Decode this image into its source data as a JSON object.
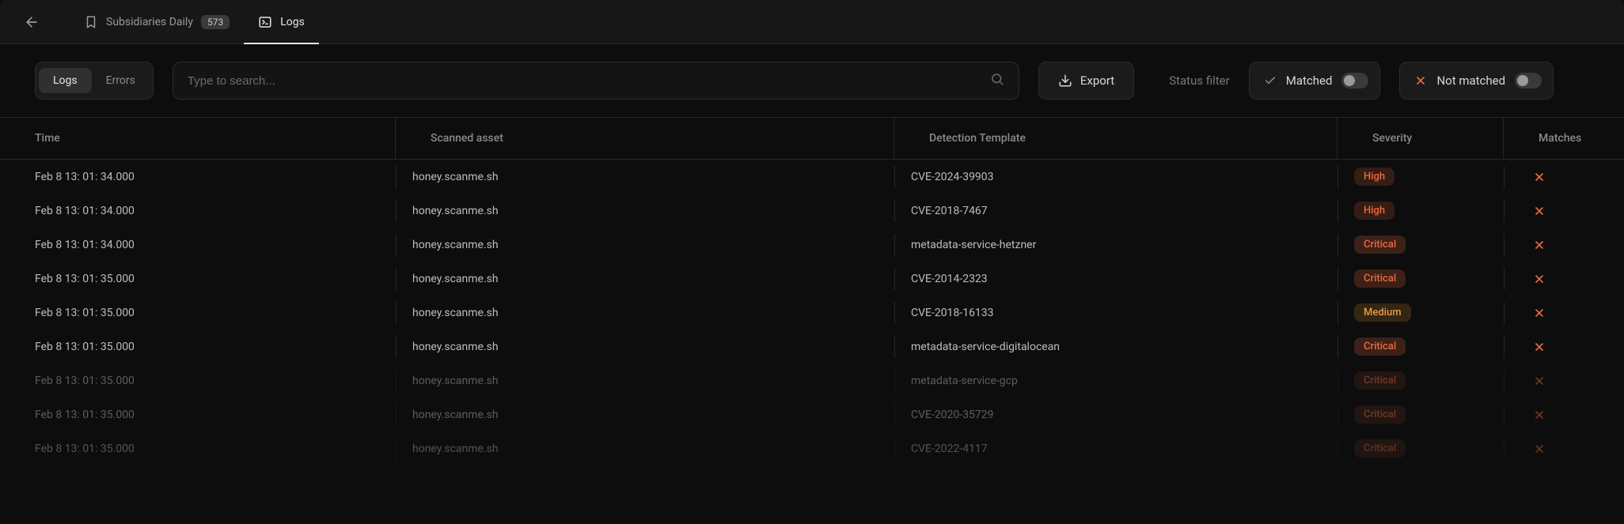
{
  "tabs": {
    "subsidiaries": {
      "label": "Subsidiaries Daily",
      "count": "573"
    },
    "logs": {
      "label": "Logs"
    }
  },
  "toolbar": {
    "segmented": {
      "logs": "Logs",
      "errors": "Errors"
    },
    "search_placeholder": "Type to search...",
    "export_label": "Export",
    "status_filter_label": "Status filter",
    "matched_label": "Matched",
    "not_matched_label": "Not matched"
  },
  "columns": {
    "time": "Time",
    "asset": "Scanned asset",
    "template": "Detection Template",
    "severity": "Severity",
    "matches": "Matches"
  },
  "rows": [
    {
      "time": "Feb 8 13: 01: 34.000",
      "asset": "honey.scanme.sh",
      "template": "CVE-2024-39903",
      "severity": "High",
      "matched": false,
      "faded": false
    },
    {
      "time": "Feb 8 13: 01: 34.000",
      "asset": "honey.scanme.sh",
      "template": "CVE-2018-7467",
      "severity": "High",
      "matched": false,
      "faded": false
    },
    {
      "time": "Feb 8 13: 01: 34.000",
      "asset": "honey.scanme.sh",
      "template": "metadata-service-hetzner",
      "severity": "Critical",
      "matched": false,
      "faded": false
    },
    {
      "time": "Feb 8 13: 01: 35.000",
      "asset": "honey.scanme.sh",
      "template": "CVE-2014-2323",
      "severity": "Critical",
      "matched": false,
      "faded": false
    },
    {
      "time": "Feb 8 13: 01: 35.000",
      "asset": "honey.scanme.sh",
      "template": "CVE-2018-16133",
      "severity": "Medium",
      "matched": false,
      "faded": false
    },
    {
      "time": "Feb 8 13: 01: 35.000",
      "asset": "honey.scanme.sh",
      "template": "metadata-service-digitalocean",
      "severity": "Critical",
      "matched": false,
      "faded": false
    },
    {
      "time": "Feb 8 13: 01: 35.000",
      "asset": "honey.scanme.sh",
      "template": "metadata-service-gcp",
      "severity": "Critical",
      "matched": false,
      "faded": true
    },
    {
      "time": "Feb 8 13: 01: 35.000",
      "asset": "honey.scanme.sh",
      "template": "CVE-2020-35729",
      "severity": "Critical",
      "matched": false,
      "faded": true
    },
    {
      "time": "Feb 8 13: 01: 35.000",
      "asset": "honey.scanme.sh",
      "template": "CVE-2022-4117",
      "severity": "Critical",
      "matched": false,
      "faded": true
    }
  ]
}
